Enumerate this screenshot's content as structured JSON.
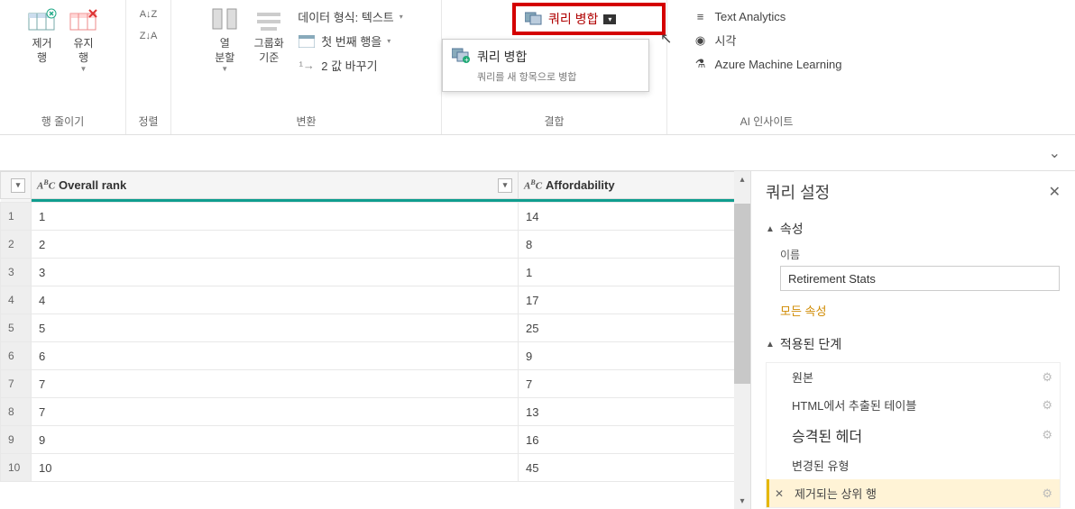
{
  "ribbon": {
    "reduce_rows": {
      "remove": {
        "label": "제거\n행"
      },
      "keep": {
        "label": "유지\n행"
      },
      "group_label": "행 줄이기"
    },
    "sort": {
      "group_label": "정렬"
    },
    "split": {
      "label": "열\n분할",
      "group_by": "그룹화\n기준",
      "transform_group": "변환",
      "data_type_label": "데이터 형식: 텍스트",
      "first_row": "첫 번째 행을",
      "replace": "2 값 바꾸기"
    },
    "combine": {
      "group_label": "결합",
      "merge_queries": "쿼리 병합",
      "dropdown_title": "쿼리 병합",
      "dropdown_sub": "쿼리를 새 항목으로 병합"
    },
    "ai": {
      "text_analytics": "Text Analytics",
      "vision": "시각",
      "aml": "Azure Machine Learning",
      "group_label": "AI 인사이트"
    }
  },
  "columns": {
    "c1": "Overall rank",
    "c2": "Affordability"
  },
  "rows": [
    {
      "n": "1",
      "c1": "1",
      "c2": "14"
    },
    {
      "n": "2",
      "c1": "2",
      "c2": "8"
    },
    {
      "n": "3",
      "c1": "3",
      "c2": "1"
    },
    {
      "n": "4",
      "c1": "4",
      "c2": "17"
    },
    {
      "n": "5",
      "c1": "5",
      "c2": "25"
    },
    {
      "n": "6",
      "c1": "6",
      "c2": "9"
    },
    {
      "n": "7",
      "c1": "7",
      "c2": "7"
    },
    {
      "n": "8",
      "c1": "7",
      "c2": "13"
    },
    {
      "n": "9",
      "c1": "9",
      "c2": "16"
    },
    {
      "n": "10",
      "c1": "10",
      "c2": "45"
    }
  ],
  "settings": {
    "title": "쿼리 설정",
    "props": "속성",
    "name_label": "이름",
    "name_value": "Retirement Stats",
    "all_props": "모든 속성",
    "steps_label": "적용된 단계",
    "steps": {
      "s1": "원본",
      "s2": "HTML에서 추출된 테이블",
      "s3": "승격된 헤더",
      "s4": "변경된 유형",
      "s5": "제거되는 상위 행"
    }
  }
}
